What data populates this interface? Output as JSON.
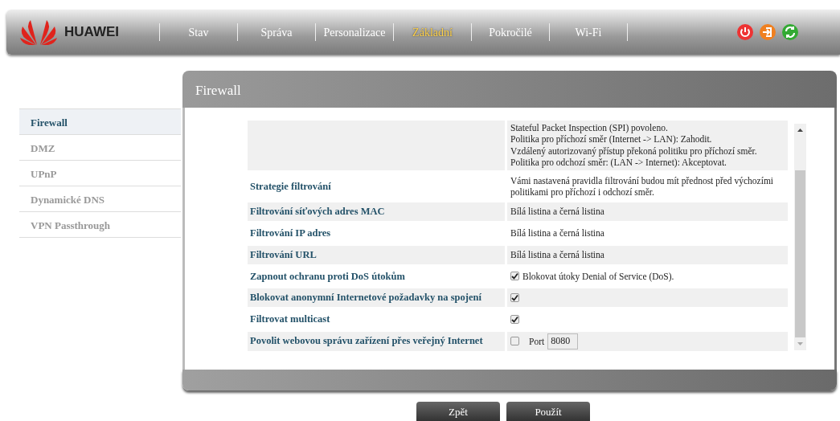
{
  "brand": "HUAWEI",
  "nav": [
    {
      "label": "Stav",
      "selected": false
    },
    {
      "label": "Správa",
      "selected": false
    },
    {
      "label": "Personalizace",
      "selected": false
    },
    {
      "label": "Základní",
      "selected": true
    },
    {
      "label": "Pokročilé",
      "selected": false
    },
    {
      "label": "Wi-Fi",
      "selected": false
    }
  ],
  "sidebar": [
    {
      "label": "Firewall",
      "selected": true
    },
    {
      "label": "DMZ",
      "selected": false
    },
    {
      "label": "UPnP",
      "selected": false
    },
    {
      "label": "Dynamické DNS",
      "selected": false
    },
    {
      "label": "VPN Passthrough",
      "selected": false
    }
  ],
  "panel": {
    "title": "Firewall"
  },
  "rows": [
    {
      "kind": "text",
      "lines": [
        "Stateful Packet Inspection (SPI) povoleno.",
        "Politika pro příchozí směr (Internet -> LAN): Zahodit.",
        "Vzdálený autorizovaný přístup překoná politiku pro příchozí směr.",
        "Politika pro odchozí směr: (LAN -> Internet): Akceptovat."
      ]
    },
    {
      "kind": "text",
      "label": "Strategie filtrování",
      "lines": [
        "Vámi nastavená pravidla filtrování budou mít přednost před výchozími politikami pro příchozí i odchozí směr."
      ]
    },
    {
      "kind": "text",
      "label": "Filtrování síťových adres MAC",
      "lines": [
        "Bílá listina a černá listina"
      ]
    },
    {
      "kind": "text",
      "label": "Filtrování IP adres",
      "lines": [
        "Bílá listina a černá listina"
      ]
    },
    {
      "kind": "text",
      "label": "Filtrování URL",
      "lines": [
        "Bílá listina a černá listina"
      ]
    },
    {
      "kind": "checkbox",
      "label": "Zapnout ochranu proti DoS útokům",
      "checked": true,
      "text": "Blokovat útoky Denial of Service (DoS)."
    },
    {
      "kind": "checkbox",
      "label": "Blokovat anonymní Internetové požadavky na spojení",
      "checked": true
    },
    {
      "kind": "checkbox",
      "label": "Filtrovat multicast",
      "checked": true
    },
    {
      "kind": "port",
      "label": "Povolit webovou správu zařízení přes veřejný Internet",
      "checked": false,
      "port_label": "Port",
      "port": "8080"
    }
  ],
  "buttons": [
    "Zpět",
    "Použít"
  ]
}
